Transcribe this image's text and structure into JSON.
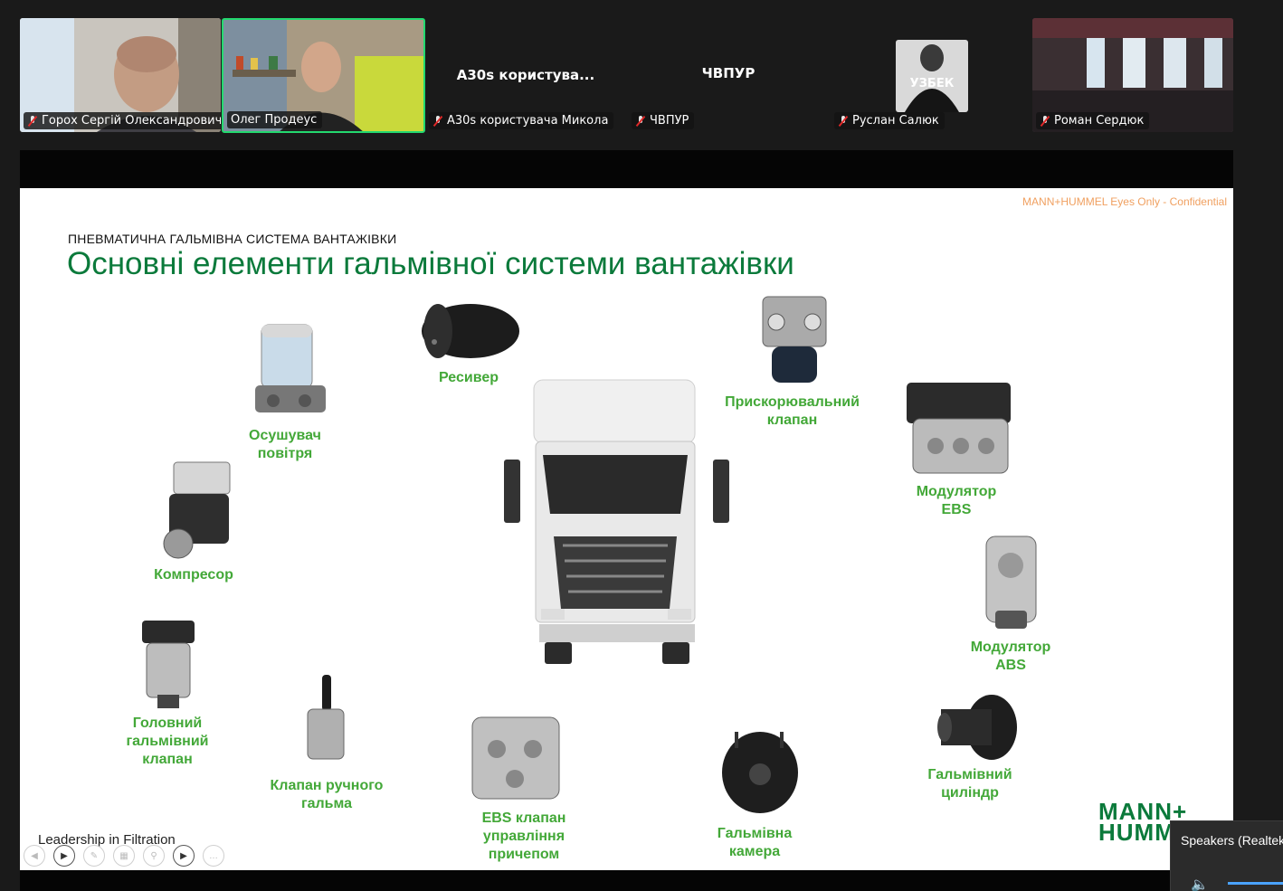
{
  "participants": [
    {
      "name": "Горох Сергій Олександрович",
      "display": ""
    },
    {
      "name": "Олег Продеус",
      "display": ""
    },
    {
      "name": "A30s користувача Микола",
      "display": "A30s  користува..."
    },
    {
      "name": "ЧВПУР",
      "display": "ЧВПУР"
    },
    {
      "name": "Руслан Салюк",
      "display": "",
      "avatar_text": "УЗБЕК"
    },
    {
      "name": "Роман Сердюк",
      "display": ""
    }
  ],
  "slide": {
    "confidential": "MANN+HUMMEL Eyes Only - Confidential",
    "subtitle": "ПНЕВМАТИЧНА ГАЛЬМІВНА СИСТЕМА ВАНТАЖІВКИ",
    "title": "Основні елементи гальмівної системи вантажівки",
    "labels": {
      "dryer": "Осушувач\nповітря",
      "receiver": "Ресивер",
      "accel_valve": "Прискорювальний\nклапан",
      "ebs_modulator": "Модулятор\nEBS",
      "compressor": "Компресор",
      "abs_modulator": "Модулятор\nABS",
      "main_valve": "Головний\nгальмівний\nклапан",
      "hand_valve": "Клапан ручного\nгальма",
      "ebs_trailer_valve": "EBS клапан\nуправління\nпричепом",
      "brake_chamber": "Гальмівна\nкамера",
      "brake_cylinder": "Гальмівний\nциліндр"
    },
    "footer": "Leadership in Filtration",
    "logo_line1": "MANN+",
    "logo_line2": "HUMM"
  },
  "audio_popup": {
    "label": "Speakers (Realtek"
  },
  "colors": {
    "accent_green": "#0b7a3b",
    "label_green": "#43a838",
    "active_speaker": "#23d96f",
    "confidential": "#f0a060"
  }
}
